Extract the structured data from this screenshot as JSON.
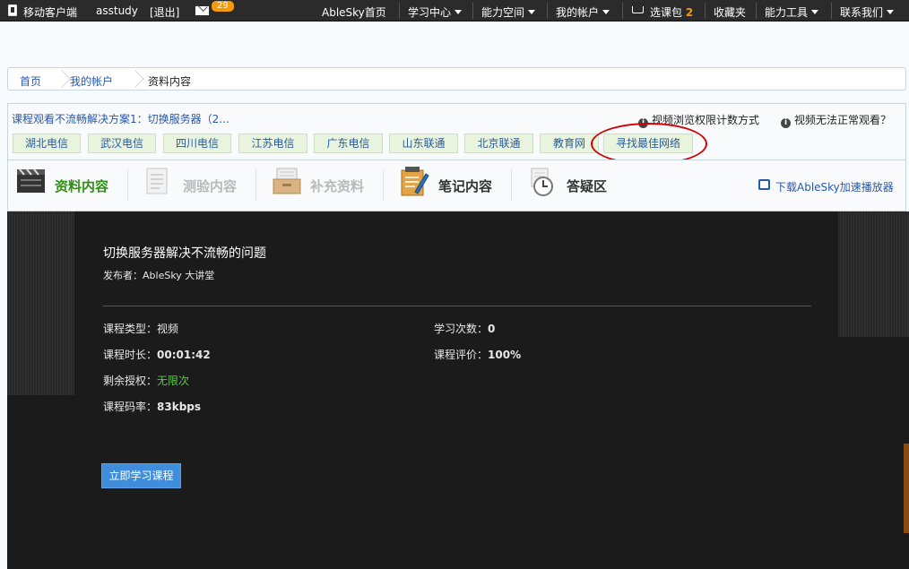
{
  "topbar": {
    "mobile_client": "移动客户端",
    "username": "asstudy",
    "logout": "[退出]",
    "mail_count": "29",
    "home": "AbleSky首页",
    "study_center": "学习中心",
    "ability_space": "能力空间",
    "my_account": "我的帐户",
    "cart_label": "选课包",
    "cart_count": "2",
    "favorites": "收藏夹",
    "ability_tools": "能力工具",
    "contact": "联系我们"
  },
  "breadcrumb": [
    "首页",
    "我的帐户",
    "资料内容"
  ],
  "notice": {
    "tip": "课程观看不流畅解决方案1：切换服务器（2...",
    "view_limit": "视频浏览权限计数方式",
    "cannot_play": "视频无法正常观看？"
  },
  "servers": [
    "湖北电信",
    "武汉电信",
    "四川电信",
    "江苏电信",
    "广东电信",
    "山东联通",
    "北京联通",
    "教育网"
  ],
  "best_network": "寻找最佳网络",
  "tabs": [
    {
      "label": "资料内容",
      "state": "active",
      "icon": "clapperboard-icon"
    },
    {
      "label": "测验内容",
      "state": "disabled",
      "icon": "quiz-sheet-icon"
    },
    {
      "label": "补充资料",
      "state": "disabled",
      "icon": "folder-box-icon"
    },
    {
      "label": "笔记内容",
      "state": "enabled",
      "icon": "notepad-pencil-icon"
    },
    {
      "label": "答疑区",
      "state": "enabled",
      "icon": "clock-icon"
    }
  ],
  "download_player": "下载AbleSky加速播放器",
  "course": {
    "title": "切换服务器解决不流畅的问题",
    "publisher": "发布者：AbleSky 大讲堂",
    "type_label": "课程类型：",
    "type_value": "视频",
    "duration_label": "课程时长：",
    "duration_value": "00:01:42",
    "remaining_label": "剩余授权：",
    "remaining_value": "无限次",
    "bitrate_label": "课程码率：",
    "bitrate_value": "83kbps",
    "study_count_label": "学习次数：",
    "study_count_value": "0",
    "rating_label": "课程评价：",
    "rating_value": "100%",
    "start_button": "立即学习课程"
  },
  "colors": {
    "topbar_bg": "#2b2b2b",
    "badge": "#f59a0c",
    "active_tab": "#2f8f12",
    "link": "#2a58a8",
    "highlight_oval": "#d40000",
    "button": "#3f8ddb",
    "green_value": "#5ec843"
  }
}
